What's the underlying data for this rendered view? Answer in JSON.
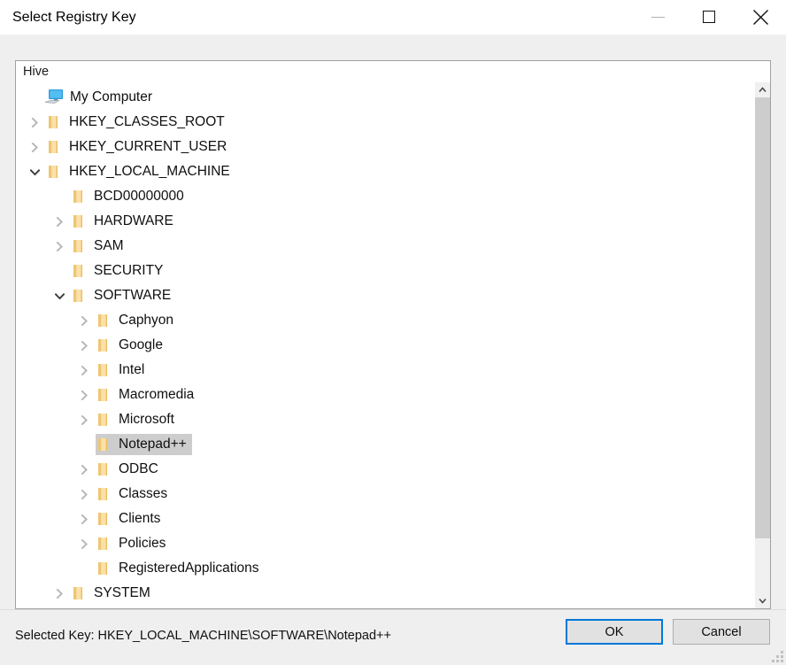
{
  "window": {
    "title": "Select Registry Key",
    "buttons": {
      "minimize": "minimize",
      "maximize": "maximize",
      "close": "close"
    }
  },
  "hive_bar": {
    "label": "Hive"
  },
  "tree": {
    "nodes": [
      {
        "label": "My Computer",
        "level": 0,
        "icon": "computer",
        "twisty": "none",
        "selected": false
      },
      {
        "label": "HKEY_CLASSES_ROOT",
        "level": 1,
        "icon": "folder",
        "twisty": "collapsed",
        "selected": false
      },
      {
        "label": "HKEY_CURRENT_USER",
        "level": 1,
        "icon": "folder",
        "twisty": "collapsed",
        "selected": false
      },
      {
        "label": "HKEY_LOCAL_MACHINE",
        "level": 1,
        "icon": "folder",
        "twisty": "expanded",
        "selected": false
      },
      {
        "label": "BCD00000000",
        "level": 2,
        "icon": "folder",
        "twisty": "none",
        "selected": false
      },
      {
        "label": "HARDWARE",
        "level": 2,
        "icon": "folder",
        "twisty": "collapsed",
        "selected": false
      },
      {
        "label": "SAM",
        "level": 2,
        "icon": "folder",
        "twisty": "collapsed",
        "selected": false
      },
      {
        "label": "SECURITY",
        "level": 2,
        "icon": "folder",
        "twisty": "none",
        "selected": false
      },
      {
        "label": "SOFTWARE",
        "level": 2,
        "icon": "folder",
        "twisty": "expanded",
        "selected": false
      },
      {
        "label": "Caphyon",
        "level": 3,
        "icon": "folder",
        "twisty": "collapsed",
        "selected": false
      },
      {
        "label": "Google",
        "level": 3,
        "icon": "folder",
        "twisty": "collapsed",
        "selected": false
      },
      {
        "label": "Intel",
        "level": 3,
        "icon": "folder",
        "twisty": "collapsed",
        "selected": false
      },
      {
        "label": "Macromedia",
        "level": 3,
        "icon": "folder",
        "twisty": "collapsed",
        "selected": false
      },
      {
        "label": "Microsoft",
        "level": 3,
        "icon": "folder",
        "twisty": "collapsed",
        "selected": false
      },
      {
        "label": "Notepad++",
        "level": 3,
        "icon": "folder",
        "twisty": "none",
        "selected": true
      },
      {
        "label": "ODBC",
        "level": 3,
        "icon": "folder",
        "twisty": "collapsed",
        "selected": false
      },
      {
        "label": "Classes",
        "level": 3,
        "icon": "folder",
        "twisty": "collapsed",
        "selected": false
      },
      {
        "label": "Clients",
        "level": 3,
        "icon": "folder",
        "twisty": "collapsed",
        "selected": false
      },
      {
        "label": "Policies",
        "level": 3,
        "icon": "folder",
        "twisty": "collapsed",
        "selected": false
      },
      {
        "label": "RegisteredApplications",
        "level": 3,
        "icon": "folder",
        "twisty": "none",
        "selected": false
      },
      {
        "label": "SYSTEM",
        "level": 2,
        "icon": "folder",
        "twisty": "collapsed",
        "selected": false
      }
    ]
  },
  "scrollbar": {
    "up_icon": "chevron-up-icon",
    "down_icon": "chevron-down-icon",
    "thumb_fraction": 0.89
  },
  "footer": {
    "selected_key_text": "Selected Key: HKEY_LOCAL_MACHINE\\SOFTWARE\\Notepad++",
    "ok_label": "OK",
    "cancel_label": "Cancel"
  },
  "colors": {
    "accent": "#0078d7",
    "folder": "#f5d27f",
    "selection": "#cdcdcd",
    "dialog_bg": "#efefef",
    "panel_bg": "#ffffff"
  }
}
